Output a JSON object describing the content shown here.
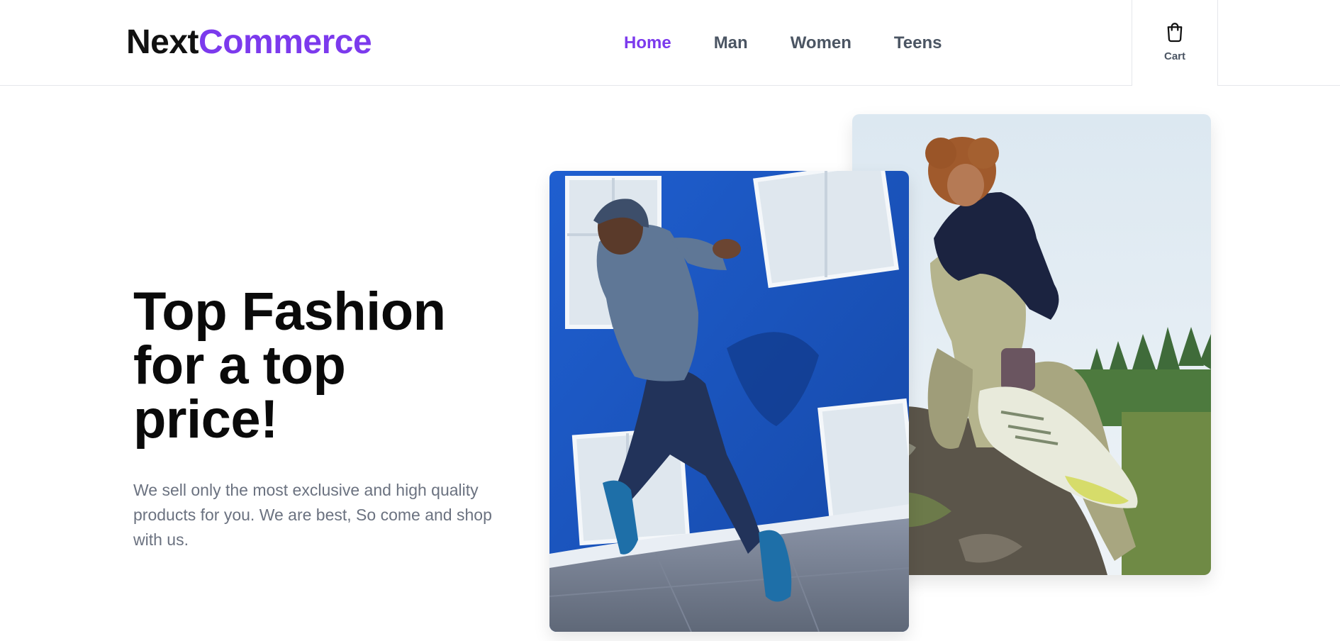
{
  "header": {
    "logo_part1": "Next",
    "logo_part2": "Commerce",
    "nav": [
      {
        "label": "Home",
        "active": true
      },
      {
        "label": "Man",
        "active": false
      },
      {
        "label": "Women",
        "active": false
      },
      {
        "label": "Teens",
        "active": false
      }
    ],
    "cart_label": "Cart",
    "cart_icon": "shopping-bag-icon"
  },
  "hero": {
    "title_line1": "Top Fashion",
    "title_line2": "for a top",
    "title_line3": "price!",
    "description": "We sell only the most exclusive and high quality products for you. We are best, So come and shop with us."
  },
  "images": [
    {
      "name": "runner-photo",
      "alt": "Runner in jacket jumping in front of blue building"
    },
    {
      "name": "sitter-photo",
      "alt": "Woman sitting on rock wearing sneakers"
    }
  ],
  "colors": {
    "accent": "#7c3aed",
    "text_dark": "#0a0a0a",
    "text_muted": "#6b7280",
    "nav_text": "#4b5563",
    "border": "#e5e7eb"
  }
}
